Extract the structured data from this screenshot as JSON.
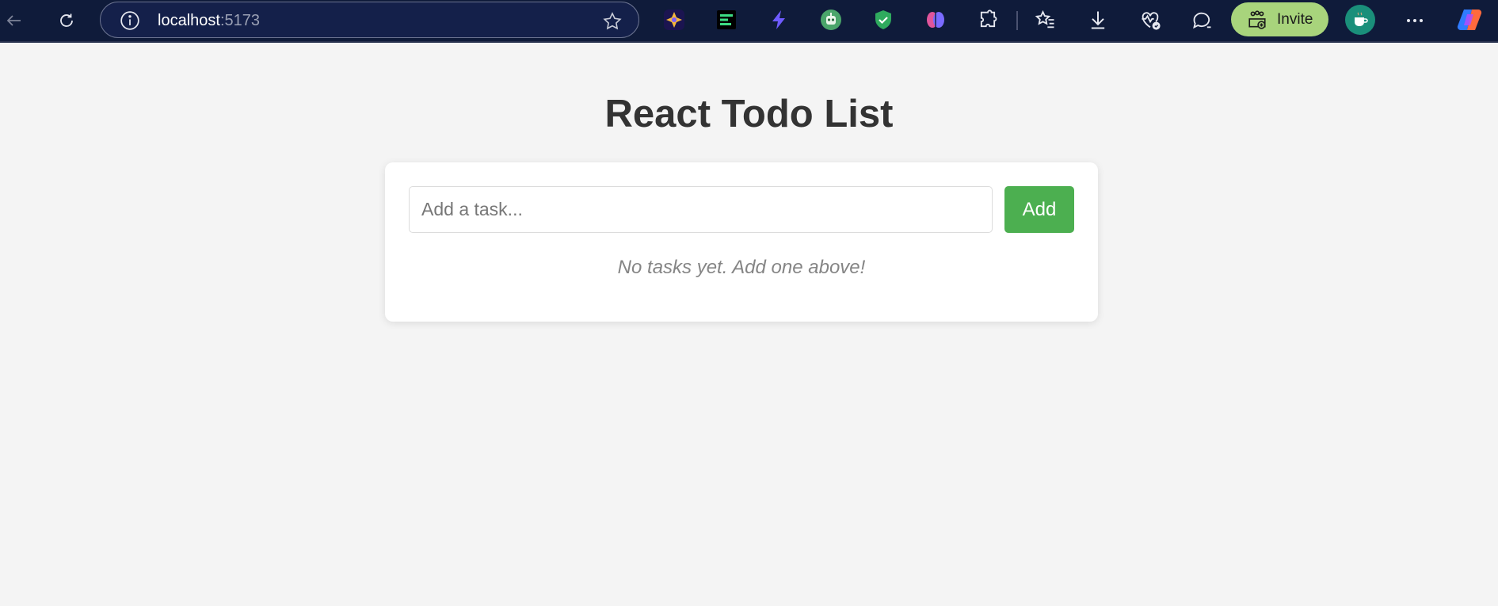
{
  "browser": {
    "url_host": "localhost",
    "url_port": ":5173",
    "invite_label": "Invite",
    "extensions": [
      "sparkle-extension-icon",
      "reader-extension-icon",
      "bolt-extension-icon",
      "robot-extension-icon",
      "shield-extension-icon",
      "brain-extension-icon",
      "puzzle-icon"
    ],
    "toolbar_icons": [
      "favorites-icon",
      "download-icon",
      "health-icon",
      "chat-icon"
    ]
  },
  "app": {
    "title": "React Todo List",
    "input_placeholder": "Add a task...",
    "input_value": "",
    "add_label": "Add",
    "empty_message": "No tasks yet. Add one above!"
  },
  "colors": {
    "toolbar_bg": "#0f1b3a",
    "page_bg": "#f4f4f4",
    "add_button": "#4caf50",
    "invite_button": "#a8d47c",
    "title": "#333333"
  }
}
